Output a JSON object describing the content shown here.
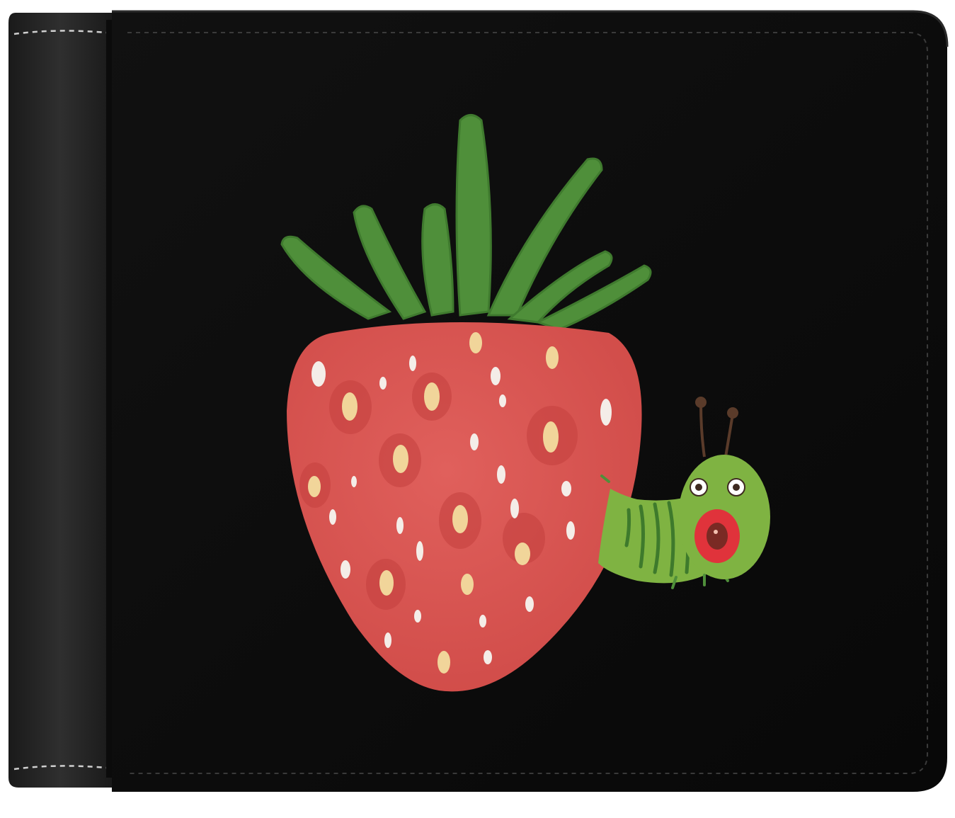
{
  "product": {
    "name": "bifold wallet",
    "description_visible": "",
    "colors": {
      "background": "#ffffff",
      "wallet_face": "#0c0c0c",
      "spine_leather": "#262626",
      "stitching": "#d9d9d9",
      "strawberry_body": "#d9534f",
      "strawberry_seed_light": "#f4ede8",
      "strawberry_seed_yellow": "#f1d59a",
      "leaf_green": "#4f8f3a",
      "caterpillar_green": "#7fb342",
      "caterpillar_mouth": "#e0333b"
    }
  }
}
